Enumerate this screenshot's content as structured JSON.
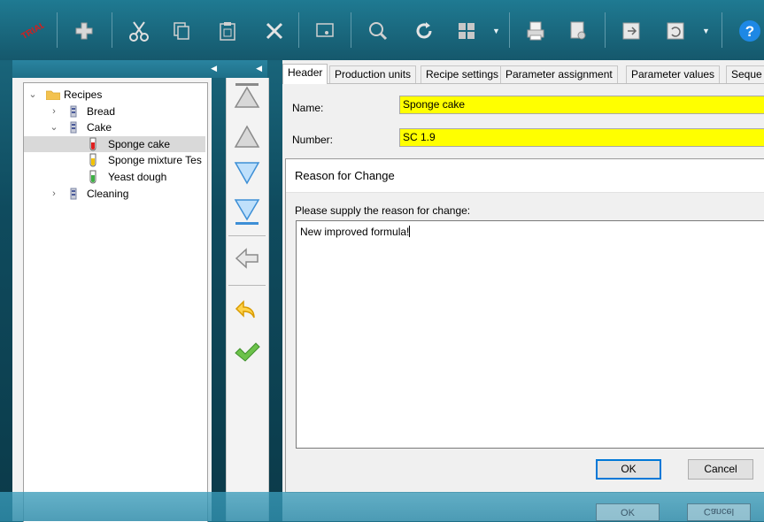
{
  "toolbar": {
    "buttons": [
      {
        "icon": "trial-stamp-icon",
        "label": "TRIAL"
      },
      {
        "icon": "add-icon"
      },
      {
        "icon": "cut-icon"
      },
      {
        "icon": "copy-icon"
      },
      {
        "icon": "paste-icon"
      },
      {
        "icon": "delete-icon"
      },
      {
        "icon": "screen-icon"
      },
      {
        "icon": "search-icon"
      },
      {
        "icon": "refresh-icon"
      },
      {
        "icon": "grid-icon"
      },
      {
        "icon": "print-icon"
      },
      {
        "icon": "print-preview-icon"
      },
      {
        "icon": "export-icon"
      },
      {
        "icon": "undo-icon"
      },
      {
        "icon": "help-icon"
      }
    ]
  },
  "tree": {
    "items": [
      {
        "label": "Recipes",
        "level": 0,
        "expanded": true,
        "icon": "folder-icon"
      },
      {
        "label": "Bread",
        "level": 1,
        "expanded": false,
        "icon": "recipe-icon"
      },
      {
        "label": "Cake",
        "level": 1,
        "expanded": true,
        "icon": "recipe-icon"
      },
      {
        "label": "Sponge cake",
        "level": 2,
        "selected": true,
        "icon": "red-tube-icon"
      },
      {
        "label": "Sponge mixture Tes",
        "level": 2,
        "icon": "yellow-tube-icon"
      },
      {
        "label": "Yeast dough",
        "level": 2,
        "icon": "green-tube-icon"
      },
      {
        "label": "Cleaning",
        "level": 1,
        "expanded": false,
        "icon": "recipe-icon"
      }
    ]
  },
  "nav": {
    "buttons": [
      "move-top-icon",
      "move-up-icon",
      "move-down-icon",
      "move-bottom-icon",
      "back-arrow-icon",
      "undo-arrow-icon",
      "confirm-check-icon"
    ]
  },
  "tabs": [
    "Header",
    "Production units",
    "Recipe settings",
    "Parameter assignment",
    "Parameter values",
    "Seque"
  ],
  "form": {
    "name_label": "Name:",
    "name_value": "Sponge cake",
    "number_label": "Number:",
    "number_value": "SC 1.9"
  },
  "dialog": {
    "title": "Reason for Change",
    "prompt": "Please supply the reason for change:",
    "text": "New improved formula!",
    "ok_label": "OK",
    "cancel_label": "Cancel"
  },
  "ghost": {
    "ok_label": "OK",
    "cancel_label": "Cancel"
  },
  "colors": {
    "field_highlight": "#ffff00",
    "accent": "#0078d7",
    "background": "#15586c"
  }
}
